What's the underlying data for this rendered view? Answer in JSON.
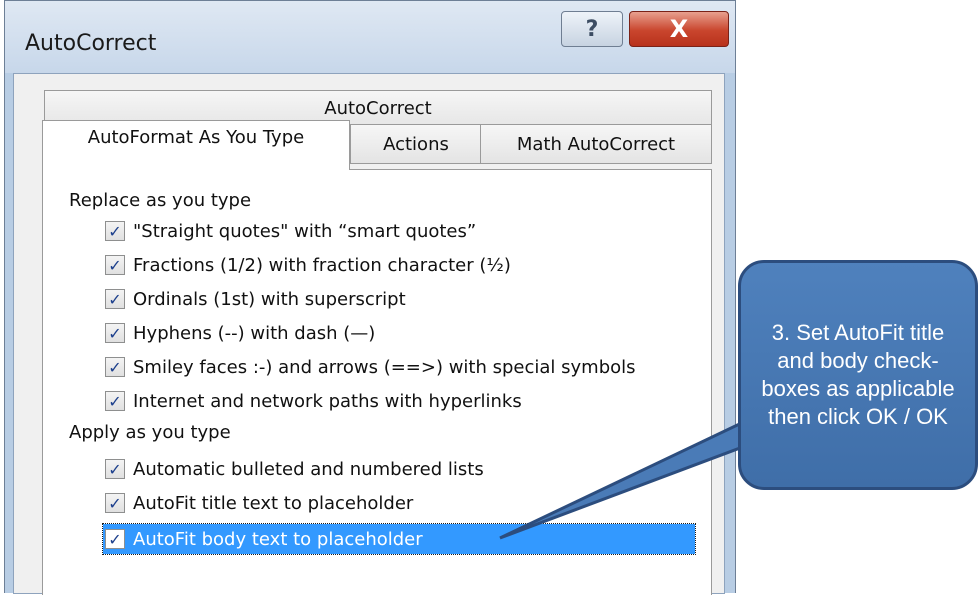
{
  "window": {
    "title": "AutoCorrect",
    "help_label": "?",
    "close_label": "X"
  },
  "tabs": {
    "back_row": [
      "AutoCorrect"
    ],
    "front_row": [
      "AutoFormat As You Type",
      "Actions",
      "Math AutoCorrect"
    ],
    "active": "AutoFormat As You Type"
  },
  "sections": {
    "replace_label": "Replace as you type",
    "apply_label": "Apply as you type"
  },
  "replace_options": [
    {
      "label": "\"Straight quotes\" with “smart quotes”",
      "checked": true
    },
    {
      "label": "Fractions (1/2) with fraction character (½)",
      "checked": true
    },
    {
      "label": "Ordinals (1st) with superscript",
      "checked": true
    },
    {
      "label": "Hyphens (--) with dash (—)",
      "checked": true
    },
    {
      "label": "Smiley faces :-) and arrows (==>) with special symbols",
      "checked": true
    },
    {
      "label": "Internet and network paths with hyperlinks",
      "checked": true
    }
  ],
  "apply_options": [
    {
      "label": "Automatic bulleted and numbered lists",
      "checked": true
    },
    {
      "label": "AutoFit title text to placeholder",
      "checked": true
    },
    {
      "label": "AutoFit body text to placeholder",
      "checked": true,
      "selected": true
    }
  ],
  "checkmark": "✓",
  "callout": {
    "text": "3. Set AutoFit title and body check-boxes as applicable then click OK / OK"
  },
  "colors": {
    "selection": "#3399ff",
    "callout_fill": "#4f81bd",
    "close_button": "#c9452d"
  }
}
